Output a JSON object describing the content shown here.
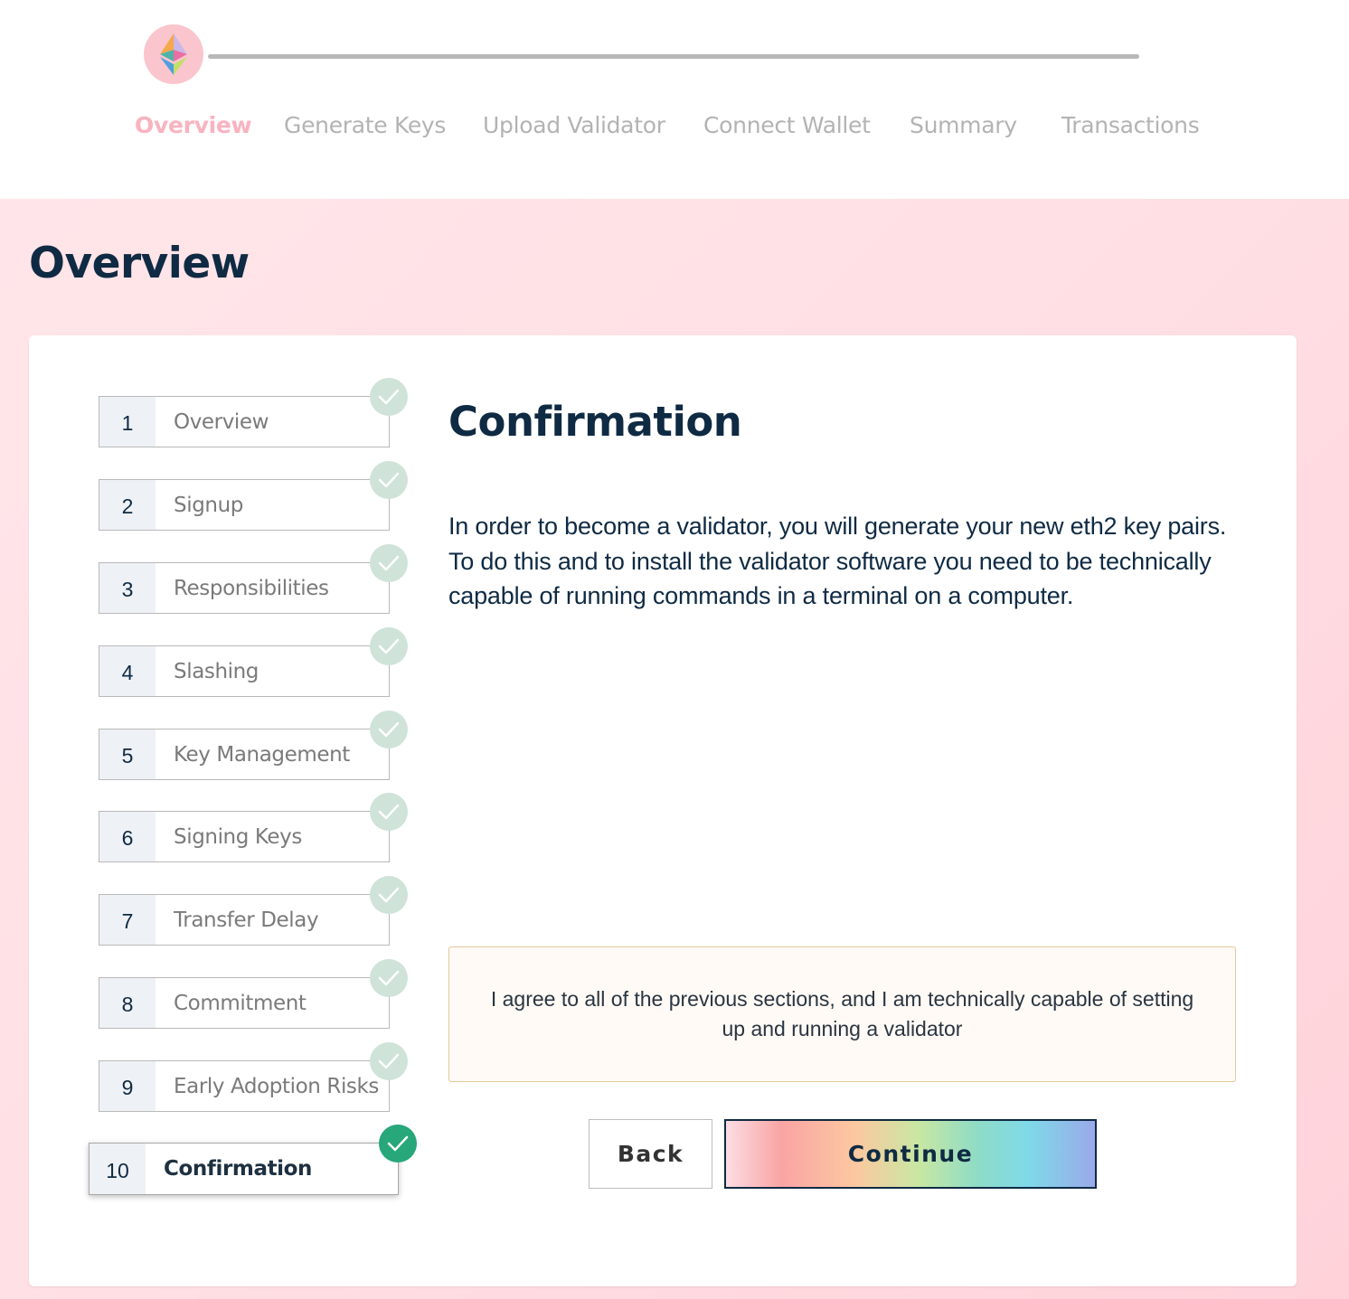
{
  "stepper": {
    "tabs": [
      {
        "label": "Overview",
        "active": true
      },
      {
        "label": "Generate Keys",
        "active": false
      },
      {
        "label": "Upload Validator",
        "active": false
      },
      {
        "label": "Connect Wallet",
        "active": false
      },
      {
        "label": "Summary",
        "active": false
      },
      {
        "label": "Transactions",
        "active": false
      }
    ],
    "logo_icon": "ethereum-icon"
  },
  "page": {
    "title": "Overview"
  },
  "checklist": {
    "items": [
      {
        "number": "1",
        "label": "Overview",
        "status": "done"
      },
      {
        "number": "2",
        "label": "Signup",
        "status": "done"
      },
      {
        "number": "3",
        "label": "Responsibilities",
        "status": "done"
      },
      {
        "number": "4",
        "label": "Slashing",
        "status": "done"
      },
      {
        "number": "5",
        "label": "Key Management",
        "status": "done"
      },
      {
        "number": "6",
        "label": "Signing Keys",
        "status": "done"
      },
      {
        "number": "7",
        "label": "Transfer Delay",
        "status": "done"
      },
      {
        "number": "8",
        "label": "Commitment",
        "status": "done"
      },
      {
        "number": "9",
        "label": "Early Adoption Risks",
        "status": "done"
      },
      {
        "number": "10",
        "label": "Confirmation",
        "status": "current"
      }
    ]
  },
  "content": {
    "title": "Confirmation",
    "description": "In order to become a validator, you will generate your new eth2 key pairs. To do this and to install the validator software you need to be technically capable of running commands in a terminal on a computer.",
    "agreement": "I agree to all of the previous sections, and I am technically capable of setting up and running a validator"
  },
  "buttons": {
    "back": "Back",
    "continue": "Continue"
  },
  "colors": {
    "accent_pink": "#f9b3bf",
    "check_done": "#cfe3d8",
    "check_current": "#27a77a",
    "heading": "#0f2a43"
  }
}
